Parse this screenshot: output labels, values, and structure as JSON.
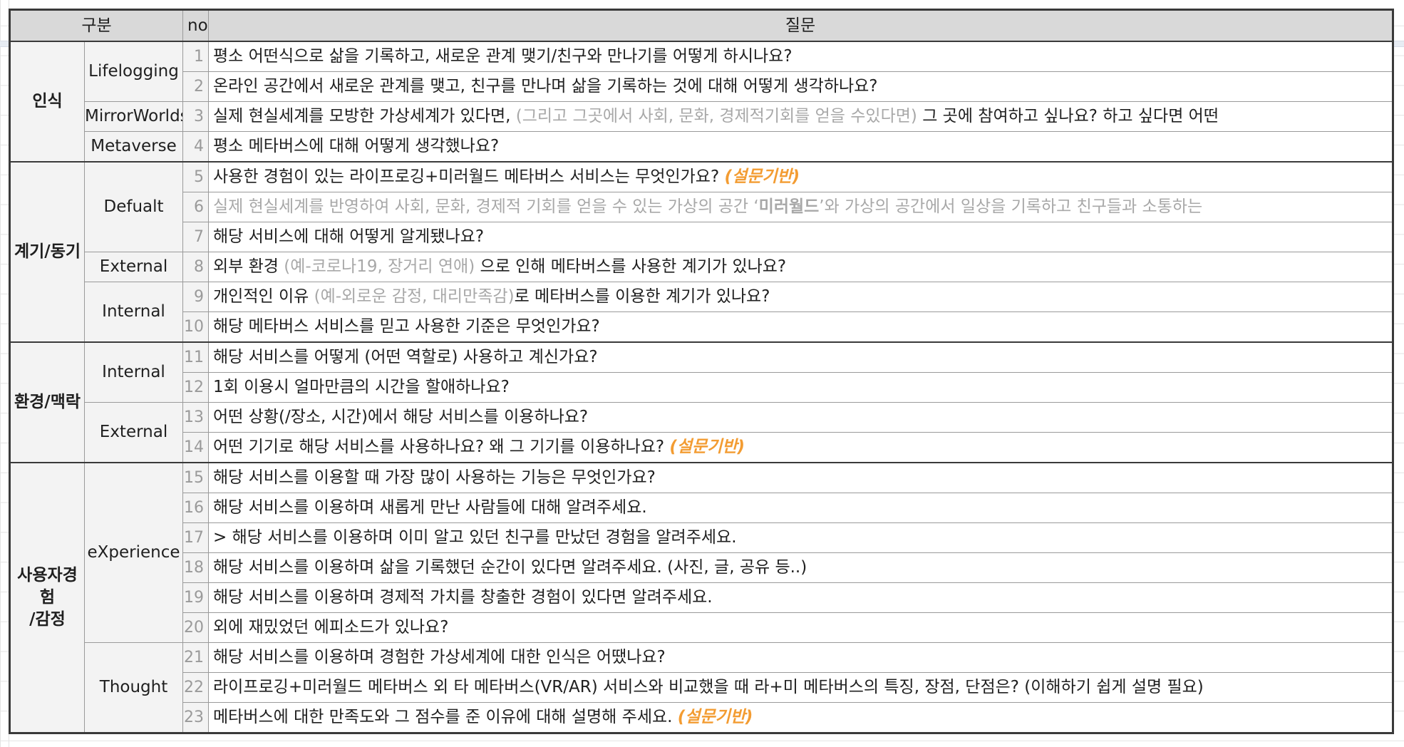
{
  "header": {
    "category": "구분",
    "no": "no",
    "question": "질문"
  },
  "tag_label": "(설문기반)",
  "categories": {
    "recognition": "인식",
    "motivation": "계기/동기",
    "environment": "환경/맥락",
    "experience_line1": "사용자경험",
    "experience_line2": "/감정"
  },
  "subcategories": {
    "lifelogging": "Lifelogging",
    "mirrorworlds": "MirrorWorlds",
    "metaverse": "Metaverse",
    "default": "Defualt",
    "external1": "External",
    "internal1": "Internal",
    "internal2": "Internal",
    "external2": "External",
    "experience": "eXperience",
    "thought": "Thought"
  },
  "rows": [
    {
      "no": "1",
      "q": "평소 어떤식으로 삶을 기록하고, 새로운 관계 맺기/친구와 만나기를 어떻게 하시나요?"
    },
    {
      "no": "2",
      "q": "온라인 공간에서 새로운 관계를 맺고, 친구를 만나며 삶을 기록하는 것에 대해 어떻게 생각하나요?"
    },
    {
      "no": "3",
      "q_a": "실제 현실세계를 모방한 가상세계가 있다면, ",
      "q_muted": "(그리고 그곳에서 사회, 문화, 경제적기회를 얻을 수있다면)",
      "q_b": " 그 곳에 참여하고 싶나요? 하고 싶다면 어떤"
    },
    {
      "no": "4",
      "q": "평소 메타버스에 대해 어떻게 생각했나요?"
    },
    {
      "no": "5",
      "q": "사용한 경험이 있는 라이프로깅+미러월드 메타버스 서비스는 무엇인가요? "
    },
    {
      "no": "6",
      "q_a": "실제 현실세계를 반영하여 사회, 문화, 경제적 기회를 얻을 수 있는 가상의 공간 ‘",
      "q_bold": "미러월드",
      "q_b": "’와 가상의 공간에서 일상을 기록하고 친구들과 소통하는"
    },
    {
      "no": "7",
      "q": "해당 서비스에 대해 어떻게 알게됐나요?"
    },
    {
      "no": "8",
      "q_a": "외부 환경 ",
      "q_muted": "(예-코로나19, 장거리 연애)",
      "q_b": " 으로 인해 메타버스를 사용한 계기가 있나요?"
    },
    {
      "no": "9",
      "q_a": "개인적인 이유 ",
      "q_muted": "(예-외로운 감정, 대리만족감)",
      "q_b": "로 메타버스를 이용한 계기가 있나요?"
    },
    {
      "no": "10",
      "q": "해당 메타버스 서비스를 믿고 사용한 기준은 무엇인가요?"
    },
    {
      "no": "11",
      "q": "해당 서비스를 어떻게 (어떤 역할로) 사용하고 계신가요?"
    },
    {
      "no": "12",
      "q": "1회 이용시 얼마만큼의 시간을 할애하나요?"
    },
    {
      "no": "13",
      "q": "어떤 상황(/장소, 시간)에서 해당 서비스를 이용하나요?"
    },
    {
      "no": "14",
      "q": "어떤 기기로 해당 서비스를 사용하나요? 왜 그 기기를 이용하나요? "
    },
    {
      "no": "15",
      "q": "해당 서비스를 이용할 때 가장 많이 사용하는 기능은 무엇인가요?"
    },
    {
      "no": "16",
      "q": "해당 서비스를 이용하며 새롭게 만난 사람들에 대해 알려주세요."
    },
    {
      "no": "17",
      "q": "> 해당 서비스를 이용하며 이미 알고 있던 친구를 만났던 경험을 알려주세요."
    },
    {
      "no": "18",
      "q": "해당 서비스를 이용하며 삶을 기록했던 순간이 있다면 알려주세요. (사진, 글, 공유 등..)"
    },
    {
      "no": "19",
      "q": "해당 서비스를 이용하며 경제적 가치를 창출한 경험이 있다면 알려주세요."
    },
    {
      "no": "20",
      "q": "외에 재밌었던 에피소드가 있나요?"
    },
    {
      "no": "21",
      "q": "해당 서비스를 이용하며 경험한 가상세계에 대한 인식은 어땠나요?"
    },
    {
      "no": "22",
      "q": "라이프로깅+미러월드 메타버스 외 타 메타버스(VR/AR) 서비스와 비교했을 때 라+미 메타버스의 특징, 장점, 단점은? (이해하기 쉽게 설명 필요)"
    },
    {
      "no": "23",
      "q": "메타버스에 대한 만족도와 그 점수를 준 이유에 대해 설명해 주세요.  "
    }
  ],
  "colors": {
    "header_bg": "#d9d9d9",
    "label_bg": "#f3f3f3",
    "muted_text": "#a8a8a8",
    "accent_orange": "#f39c32",
    "border_dark": "#3a3a3a"
  }
}
